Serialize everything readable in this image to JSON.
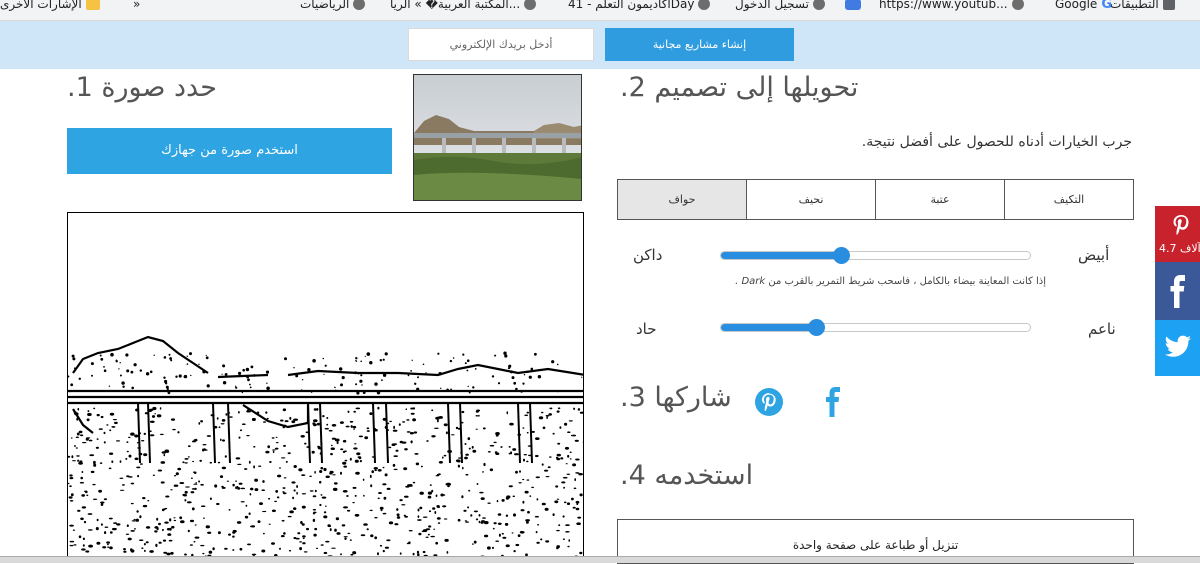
{
  "bookmarks": [
    {
      "label": "التطبيقات",
      "icon": "apps-icon"
    },
    {
      "label": "Google",
      "icon": "google-icon"
    },
    {
      "label": "https://www.youtub...",
      "icon": "youtube-icon"
    },
    {
      "label": "تسجيل الدخول",
      "icon": "globe-icon"
    },
    {
      "label": "أكاديمون التعلم - 41Day",
      "icon": "globe-icon"
    },
    {
      "label": "المكتبة العربية� » الريا...",
      "icon": "globe-icon"
    },
    {
      "label": "الرياضيات",
      "icon": "globe-icon"
    },
    {
      "label": "الإشارات الأخرى",
      "icon": "folder-icon"
    }
  ],
  "overflow_chevron": "»",
  "banner": {
    "email_placeholder": "أدخل بريدك الإلكتروني",
    "create_button": "إنشاء مشاريع مجانية"
  },
  "step1": {
    "heading": "حدد صورة 1.",
    "button": "استخدم صورة من جهازك"
  },
  "step2": {
    "heading": "تحويلها إلى تصميم 2.",
    "hint": "جرب الخيارات أدناه للحصول على أفضل نتيجة.",
    "tabs": [
      {
        "label": "التكيف",
        "active": false
      },
      {
        "label": "عتبة",
        "active": false
      },
      {
        "label": "نحيف",
        "active": false
      },
      {
        "label": "حواف",
        "active": true
      }
    ],
    "slider1": {
      "left_label": "داكن",
      "right_label": "أبيض",
      "value_fraction": 0.39
    },
    "dark_hint": "إذا كانت المعاينة بيضاء بالكامل ، فاسحب شريط التمرير بالقرب من",
    "dark_hint_em": "Dark .",
    "slider2": {
      "left_label": "حاد",
      "right_label": "ناعم",
      "value_fraction": 0.31
    }
  },
  "step3": {
    "heading": "شاركها 3."
  },
  "step4": {
    "heading": "استخدمه 4.",
    "download": "تنزيل أو طباعة على صفحة واحدة"
  },
  "side_share": {
    "pinterest_count": "4.7",
    "pinterest_suffix": "آلاف"
  },
  "colors": {
    "accent": "#2ea4e3",
    "banner": "#cfe6f8",
    "pinterest": "#c8232c",
    "facebook": "#3b5998",
    "twitter": "#1da1f2"
  }
}
